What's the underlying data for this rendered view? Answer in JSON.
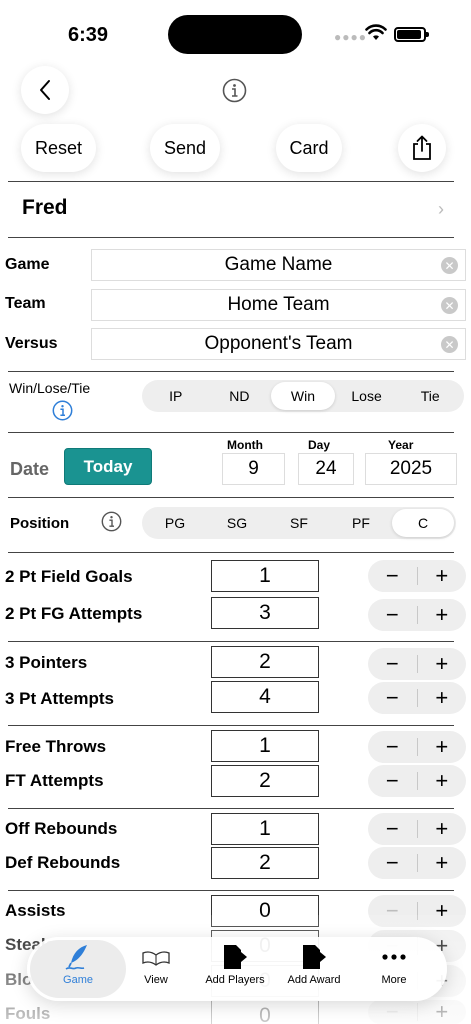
{
  "status": {
    "time": "6:39"
  },
  "header": {
    "reset": "Reset",
    "send": "Send",
    "card": "Card"
  },
  "player": {
    "name": "Fred"
  },
  "fields": {
    "game": {
      "label": "Game",
      "value": "Game Name"
    },
    "team": {
      "label": "Team",
      "value": "Home Team"
    },
    "versus": {
      "label": "Versus",
      "value": "Opponent's Team"
    }
  },
  "result": {
    "label": "Win/Lose/Tie",
    "options": [
      "IP",
      "ND",
      "Win",
      "Lose",
      "Tie"
    ],
    "selected": "Win"
  },
  "date": {
    "label": "Date",
    "today": "Today",
    "month_label": "Month",
    "day_label": "Day",
    "year_label": "Year",
    "month": "9",
    "day": "24",
    "year": "2025"
  },
  "position": {
    "label": "Position",
    "options": [
      "PG",
      "SG",
      "SF",
      "PF",
      "C"
    ],
    "selected": "C"
  },
  "stats": [
    {
      "label": "2 Pt Field Goals",
      "value": "1"
    },
    {
      "label": "2 Pt FG Attempts",
      "value": "3"
    },
    {
      "label": "3 Pointers",
      "value": "2"
    },
    {
      "label": "3 Pt Attempts",
      "value": "4"
    },
    {
      "label": "Free Throws",
      "value": "1"
    },
    {
      "label": "FT Attempts",
      "value": "2"
    },
    {
      "label": "Off Rebounds",
      "value": "1"
    },
    {
      "label": "Def Rebounds",
      "value": "2"
    },
    {
      "label": "Assists",
      "value": "0"
    },
    {
      "label": "Steals",
      "value": "0"
    },
    {
      "label": "Blocks",
      "value": "0"
    },
    {
      "label": "Fouls",
      "value": "0"
    }
  ],
  "tabs": {
    "game": "Game",
    "view": "View",
    "add_players": "Add Players",
    "add_award": "Add Award",
    "more": "More"
  },
  "colors": {
    "accent": "#1a9391",
    "tab_active": "#2f7fd8"
  }
}
